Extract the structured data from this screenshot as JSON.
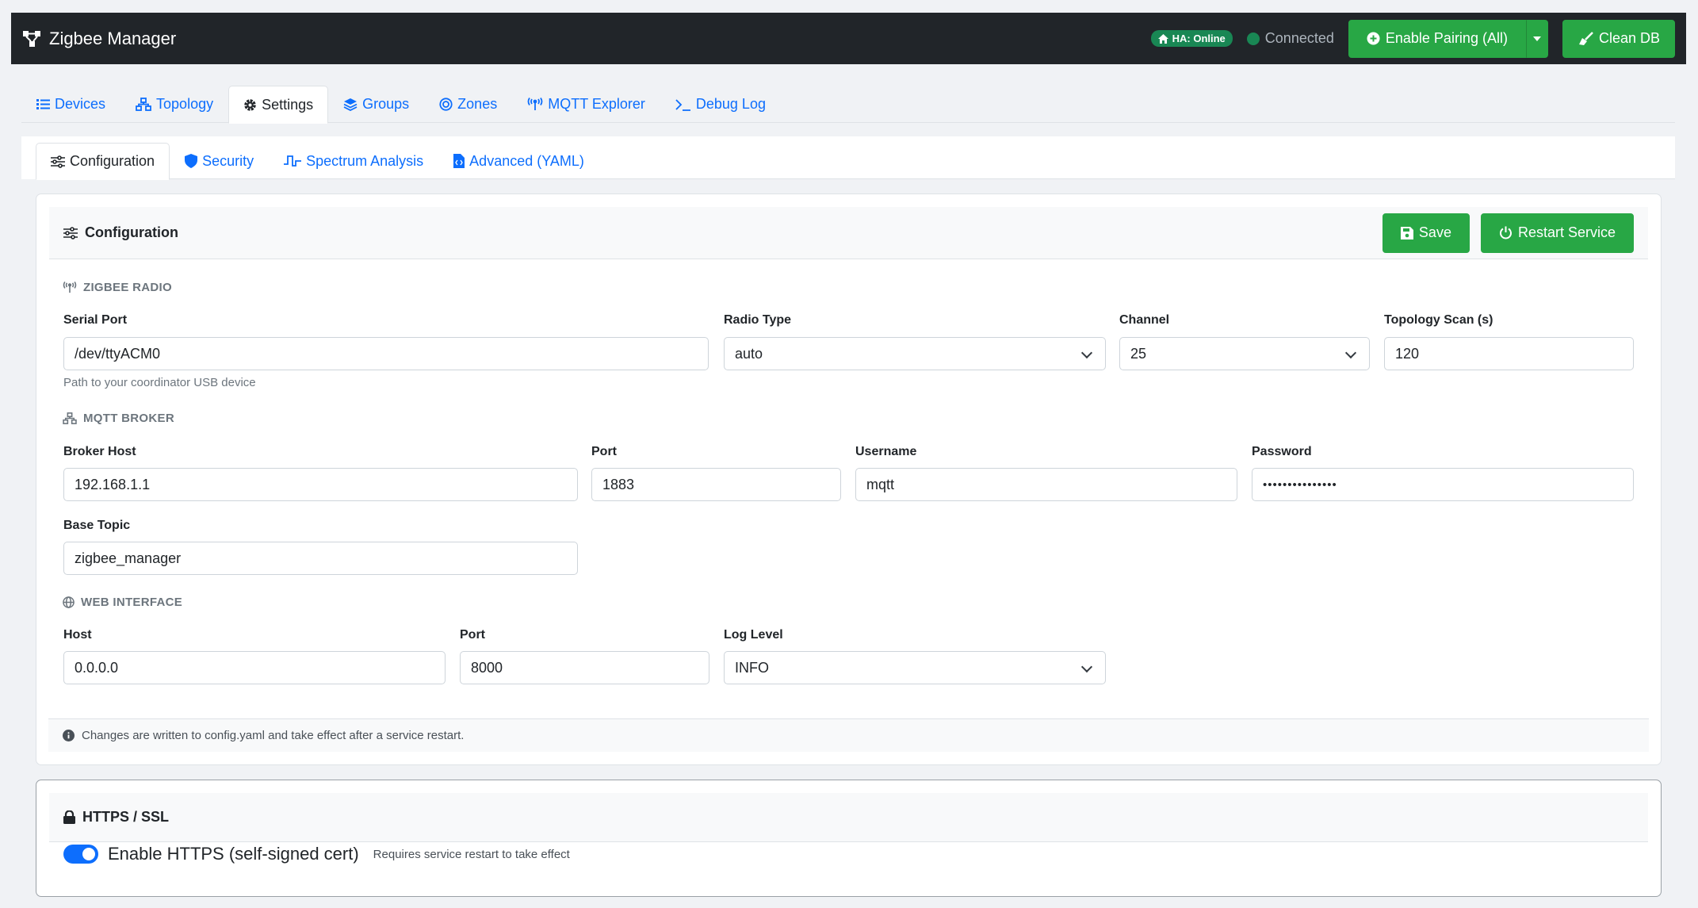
{
  "app": {
    "title": "Zigbee Manager",
    "ha_badge": "HA: Online",
    "connection_status": "Connected",
    "enable_pairing_label": "Enable Pairing (All)",
    "clean_db_label": "Clean DB"
  },
  "main_tabs": [
    {
      "label": "Devices",
      "icon": "list-icon"
    },
    {
      "label": "Topology",
      "icon": "network-icon"
    },
    {
      "label": "Settings",
      "icon": "gear-icon",
      "active": true
    },
    {
      "label": "Groups",
      "icon": "layers-icon"
    },
    {
      "label": "Zones",
      "icon": "target-icon"
    },
    {
      "label": "MQTT Explorer",
      "icon": "antenna-icon"
    },
    {
      "label": "Debug Log",
      "icon": "terminal-icon"
    }
  ],
  "sub_tabs": [
    {
      "label": "Configuration",
      "icon": "sliders-icon",
      "active": true
    },
    {
      "label": "Security",
      "icon": "shield-icon"
    },
    {
      "label": "Spectrum Analysis",
      "icon": "wave-icon"
    },
    {
      "label": "Advanced (YAML)",
      "icon": "file-code-icon"
    }
  ],
  "config": {
    "title": "Configuration",
    "save_label": "Save",
    "restart_label": "Restart Service",
    "zigbee_radio": {
      "heading": "ZIGBEE RADIO",
      "serial_port_label": "Serial Port",
      "serial_port_value": "/dev/ttyACM0",
      "serial_port_help": "Path to your coordinator USB device",
      "radio_type_label": "Radio Type",
      "radio_type_value": "auto",
      "channel_label": "Channel",
      "channel_value": "25",
      "topology_scan_label": "Topology Scan (s)",
      "topology_scan_value": "120"
    },
    "mqtt": {
      "heading": "MQTT BROKER",
      "host_label": "Broker Host",
      "host_value": "192.168.1.1",
      "port_label": "Port",
      "port_value": "1883",
      "username_label": "Username",
      "username_value": "mqtt",
      "password_label": "Password",
      "password_value": "•••••••••••••••",
      "base_topic_label": "Base Topic",
      "base_topic_value": "zigbee_manager"
    },
    "web": {
      "heading": "WEB INTERFACE",
      "host_label": "Host",
      "host_value": "0.0.0.0",
      "port_label": "Port",
      "port_value": "8000",
      "log_level_label": "Log Level",
      "log_level_value": "INFO"
    },
    "footer_note": "Changes are written to config.yaml and take effect after a service restart."
  },
  "https": {
    "title": "HTTPS / SSL",
    "toggle_label": "Enable HTTPS (self-signed cert)",
    "toggle_help": "Requires service restart to take effect",
    "enabled": true
  },
  "colors": {
    "navbar": "#212529",
    "accent_green": "#28a745",
    "link_blue": "#0d6efd",
    "badge_green": "#198754"
  }
}
